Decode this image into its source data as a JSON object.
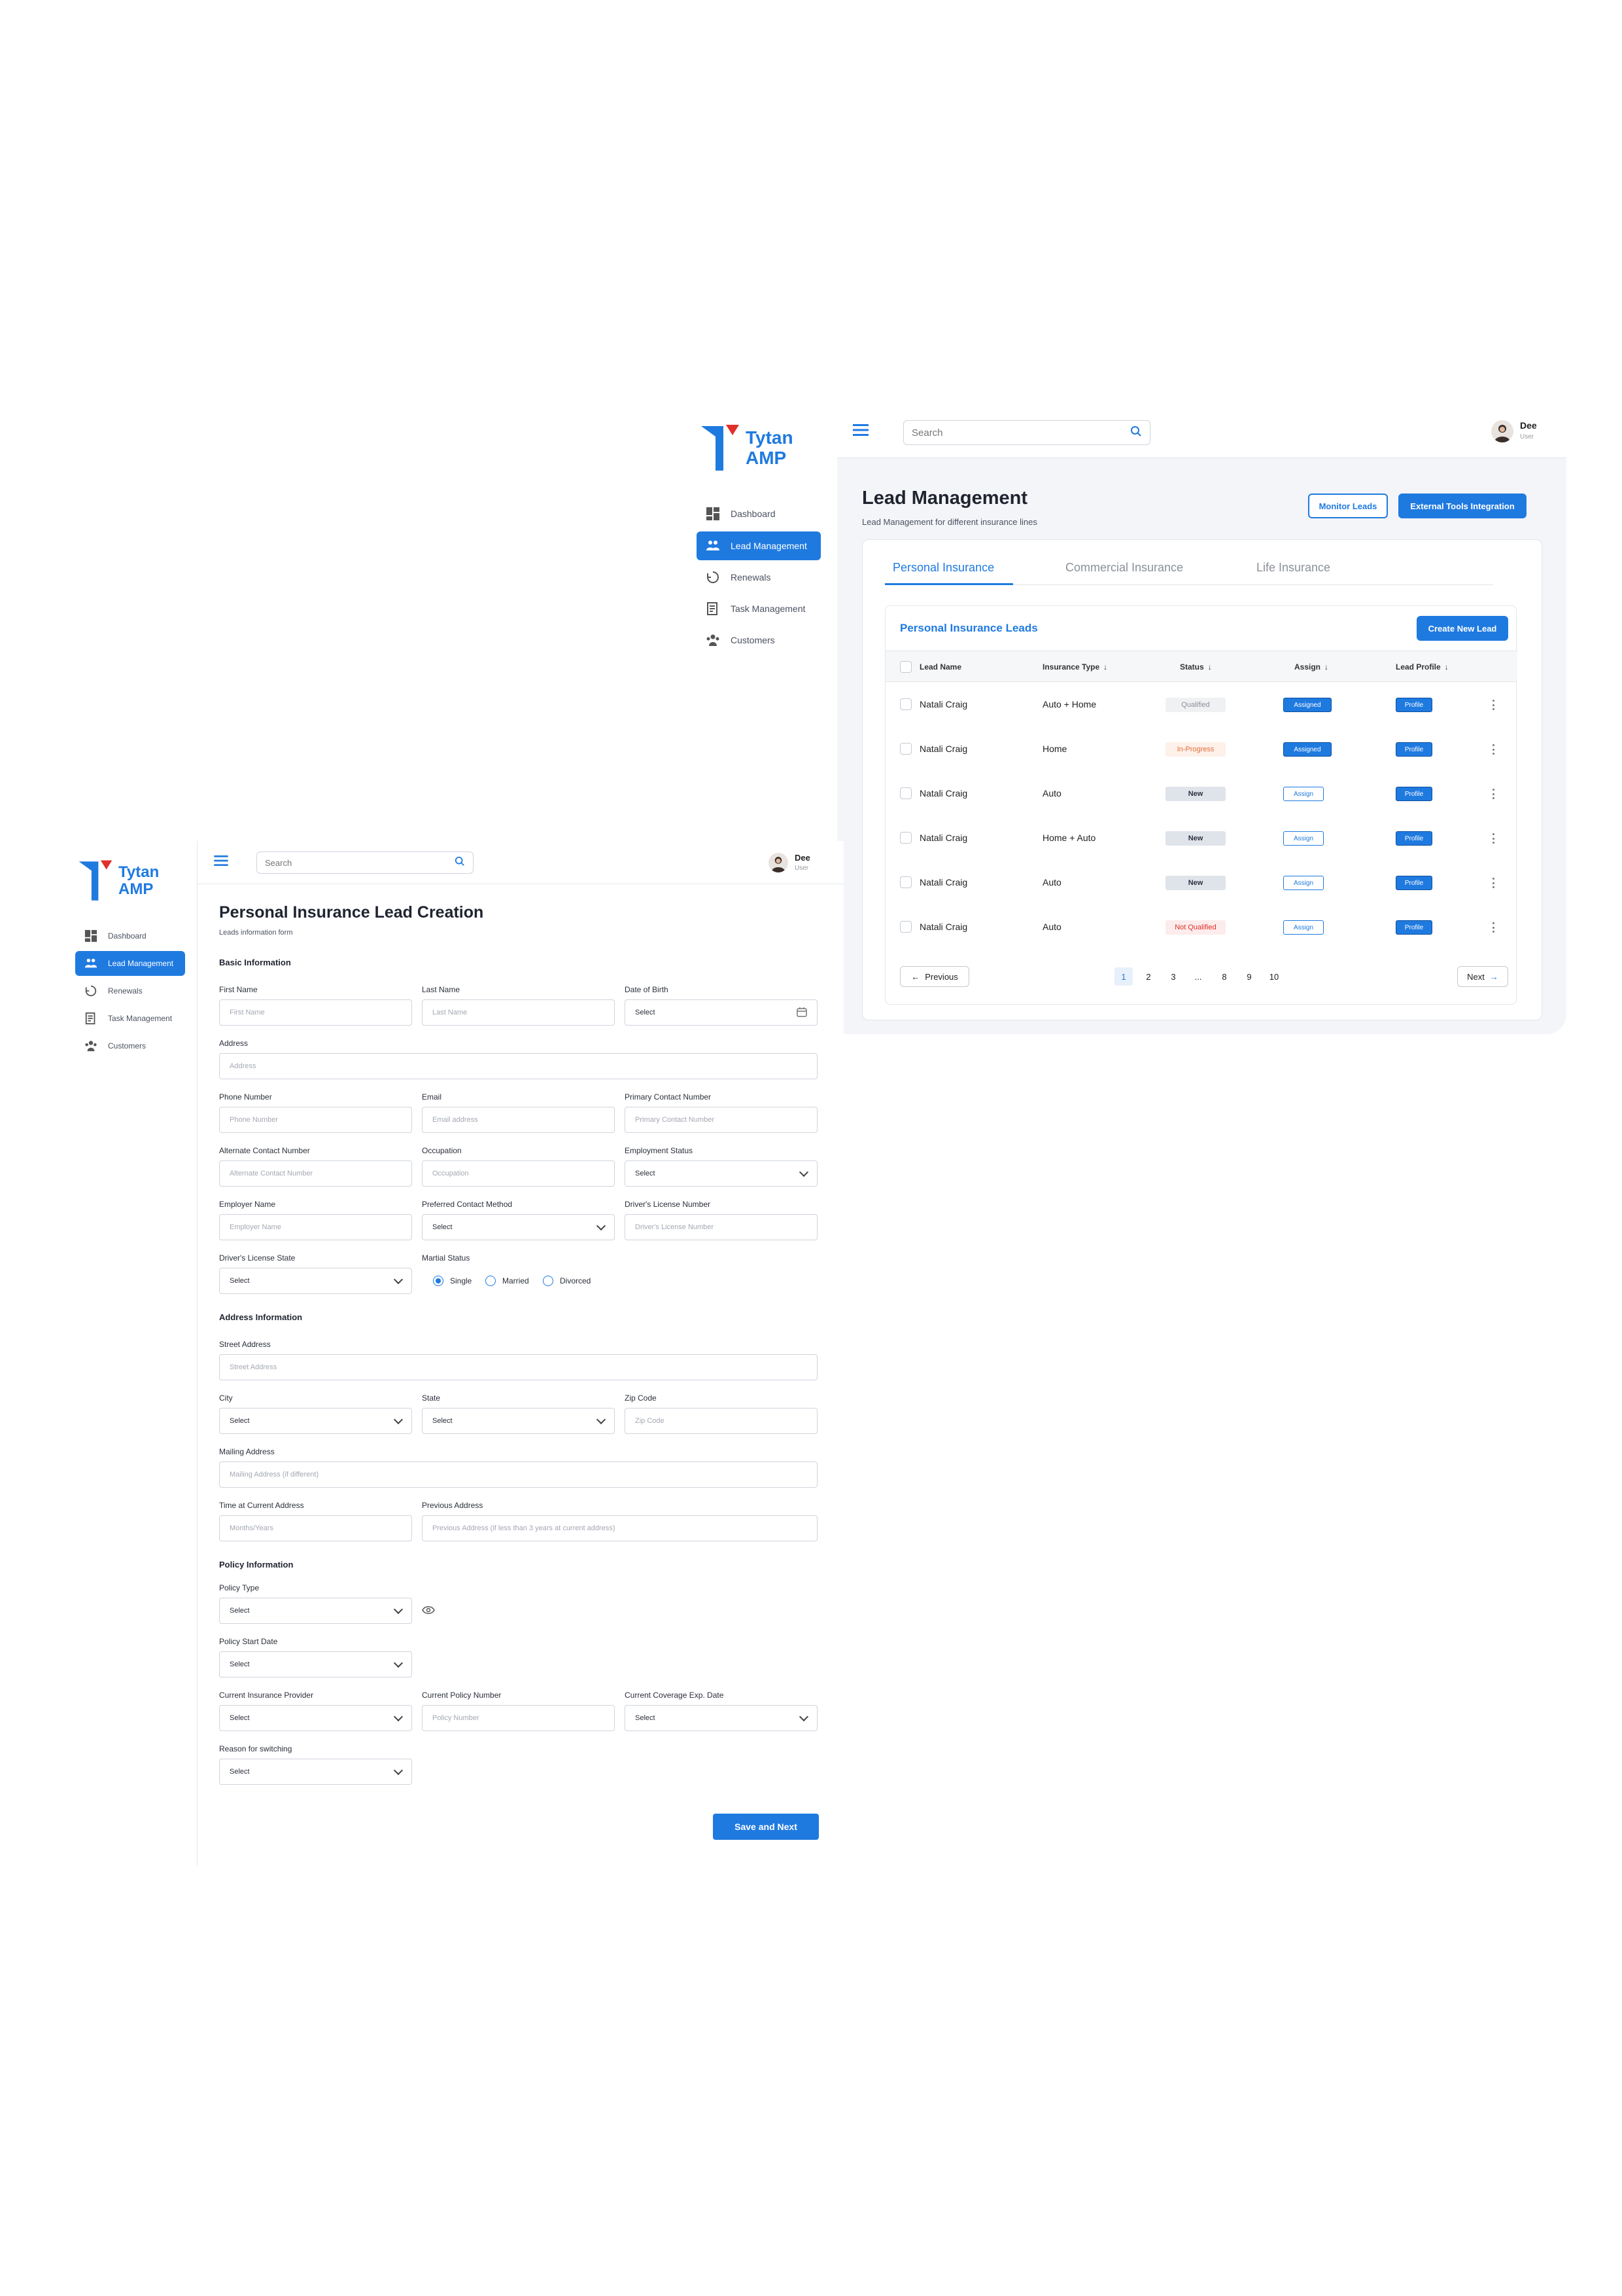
{
  "brand": {
    "name_line1": "Tytan",
    "name_line2": "AMP",
    "color": "#1f7ae0",
    "accent": "#e0302a"
  },
  "nav": [
    {
      "label": "Dashboard",
      "icon": "dashboard-icon"
    },
    {
      "label": "Lead Management",
      "icon": "lead-management-icon",
      "active": true
    },
    {
      "label": "Renewals",
      "icon": "renewals-icon"
    },
    {
      "label": "Task Management",
      "icon": "task-management-icon"
    },
    {
      "label": "Customers",
      "icon": "customers-icon"
    }
  ],
  "header": {
    "search_placeholder": "Search",
    "user_name": "Dee",
    "user_role": "User"
  },
  "lead_management": {
    "title": "Lead Management",
    "subtitle": "Lead Management for different insurance lines",
    "monitor_button": "Monitor Leads",
    "external_button": "External Tools Integration",
    "tabs": [
      "Personal Insurance",
      "Commercial Insurance",
      "Life Insurance"
    ],
    "active_tab": "Personal Insurance",
    "panel_title": "Personal Insurance Leads",
    "create_button": "Create New Lead",
    "columns": [
      "Lead Name",
      "Insurance Type",
      "Status",
      "Assign",
      "Lead Profile"
    ],
    "rows": [
      {
        "name": "Natali Craig",
        "type": "Auto + Home",
        "status": "Qualified",
        "assign": "Assigned",
        "profile": "Profile"
      },
      {
        "name": "Natali Craig",
        "type": "Home",
        "status": "In-Progress",
        "assign": "Assigned",
        "profile": "Profile"
      },
      {
        "name": "Natali Craig",
        "type": "Auto",
        "status": "New",
        "assign": "Assign",
        "profile": "Profile"
      },
      {
        "name": "Natali Craig",
        "type": "Home + Auto",
        "status": "New",
        "assign": "Assign",
        "profile": "Profile"
      },
      {
        "name": "Natali Craig",
        "type": "Auto",
        "status": "New",
        "assign": "Assign",
        "profile": "Profile"
      },
      {
        "name": "Natali Craig",
        "type": "Auto",
        "status": "Not Qualified",
        "assign": "Assign",
        "profile": "Profile"
      }
    ],
    "pagination": {
      "previous": "Previous",
      "next": "Next",
      "pages": [
        "1",
        "2",
        "3",
        "...",
        "8",
        "9",
        "10"
      ],
      "current": "1"
    }
  },
  "form": {
    "title": "Personal Insurance Lead Creation",
    "subtitle": "Leads information form",
    "basic_section": "Basic Information",
    "address_section": "Address Information",
    "policy_section": "Policy Information",
    "fields": {
      "first_name": {
        "label": "First Name",
        "placeholder": "First Name"
      },
      "last_name": {
        "label": "Last Name",
        "placeholder": "Last Name"
      },
      "dob": {
        "label": "Date of Birth",
        "value": "Select"
      },
      "address": {
        "label": "Address",
        "placeholder": "Address"
      },
      "phone": {
        "label": "Phone Number",
        "placeholder": "Phone Number"
      },
      "email": {
        "label": "Email",
        "placeholder": "Email address"
      },
      "primary_contact": {
        "label": "Primary Contact Number",
        "placeholder": "Primary Contact Number"
      },
      "alternate_contact": {
        "label": "Alternate Contact Number",
        "placeholder": "Alternate Contact Number"
      },
      "occupation": {
        "label": "Occupation",
        "placeholder": "Occupation"
      },
      "employment_status": {
        "label": "Employment Status",
        "value": "Select"
      },
      "employer_name": {
        "label": "Employer Name",
        "placeholder": "Employer Name"
      },
      "preferred_contact": {
        "label": "Preferred Contact Method",
        "value": "Select"
      },
      "license_number": {
        "label": "Driver's License Number",
        "placeholder": "Driver's License Number"
      },
      "license_state": {
        "label": "Driver's License State",
        "value": "Select"
      },
      "marital_status": {
        "label": "Martial Status",
        "options": [
          "Single",
          "Married",
          "Divorced"
        ],
        "selected": "Single"
      },
      "street_address": {
        "label": "Street Address",
        "placeholder": "Street Address"
      },
      "city": {
        "label": "City",
        "value": "Select"
      },
      "state": {
        "label": "State",
        "value": "Select"
      },
      "zip": {
        "label": "Zip Code",
        "placeholder": "Zip Code"
      },
      "mailing_address": {
        "label": "Mailing Address",
        "placeholder": "Mailing Address (if different)"
      },
      "time_at_address": {
        "label": "Time at Current Address",
        "placeholder": "Months/Years"
      },
      "previous_address": {
        "label": "Previous Address",
        "placeholder": "Previous Address (if less than 3 years at current address)"
      },
      "policy_type": {
        "label": "Policy Type",
        "value": "Select"
      },
      "policy_start": {
        "label": "Policy Start Date",
        "value": "Select"
      },
      "current_provider": {
        "label": "Current Insurance Provider",
        "value": "Select"
      },
      "policy_number": {
        "label": "Current Policy Number",
        "placeholder": "Policy Number"
      },
      "coverage_exp": {
        "label": "Current Coverage Exp. Date",
        "value": "Select"
      },
      "switch_reason": {
        "label": "Reason for switching",
        "value": "Select"
      }
    },
    "submit": "Save and Next"
  }
}
